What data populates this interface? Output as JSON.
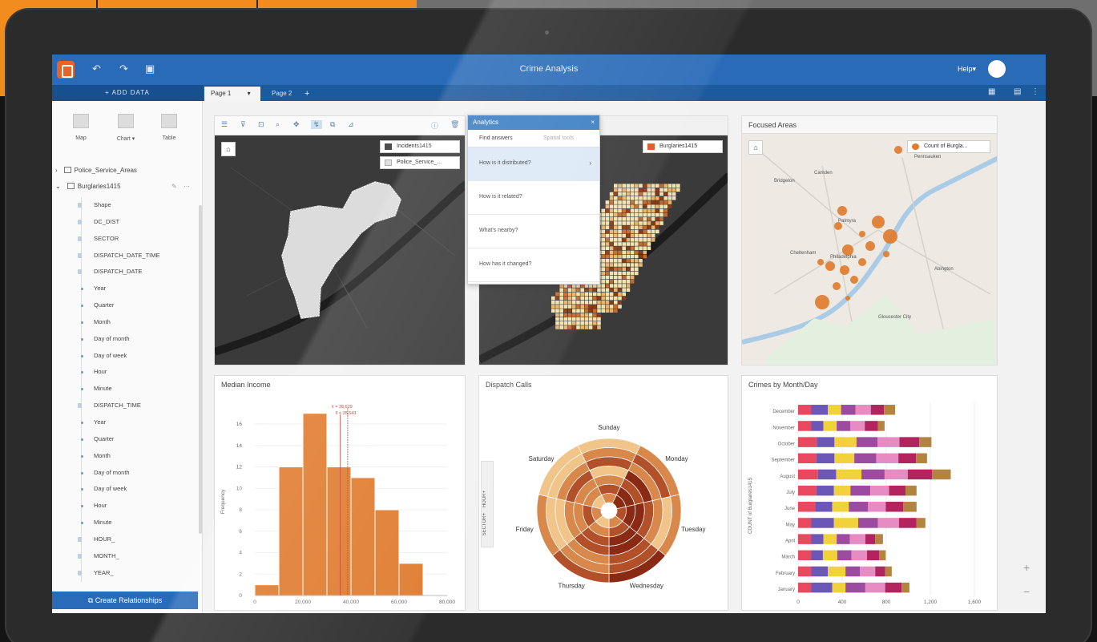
{
  "app": {
    "title": "Crime Analysis",
    "help_label": "Help",
    "add_data_label": "+ ADD DATA",
    "tabs": [
      {
        "label": "Page 1"
      },
      {
        "label": "Page 2"
      }
    ],
    "add_tab_symbol": "+"
  },
  "left_pane": {
    "viz_buttons": [
      {
        "label": "Map"
      },
      {
        "label": "Chart ▾"
      },
      {
        "label": "Table"
      }
    ],
    "datasets": [
      {
        "label": "Police_Service_Areas"
      },
      {
        "label": "Burglaries1415"
      }
    ],
    "fields": [
      {
        "label": "Shape",
        "sub": false
      },
      {
        "label": "DC_DIST",
        "sub": false
      },
      {
        "label": "SECTOR",
        "sub": false
      },
      {
        "label": "DISPATCH_DATE_TIME",
        "sub": false
      },
      {
        "label": "DISPATCH_DATE",
        "sub": false
      },
      {
        "label": "Year",
        "sub": true
      },
      {
        "label": "Quarter",
        "sub": true
      },
      {
        "label": "Month",
        "sub": true
      },
      {
        "label": "Day of month",
        "sub": true
      },
      {
        "label": "Day of week",
        "sub": true
      },
      {
        "label": "Hour",
        "sub": true
      },
      {
        "label": "Minute",
        "sub": true
      },
      {
        "label": "DISPATCH_TIME",
        "sub": false
      },
      {
        "label": "Year",
        "sub": true
      },
      {
        "label": "Quarter",
        "sub": true
      },
      {
        "label": "Month",
        "sub": true
      },
      {
        "label": "Day of month",
        "sub": true
      },
      {
        "label": "Day of week",
        "sub": true
      },
      {
        "label": "Hour",
        "sub": true
      },
      {
        "label": "Minute",
        "sub": true
      },
      {
        "label": "HOUR_",
        "sub": false
      },
      {
        "label": "MONTH_",
        "sub": false
      },
      {
        "label": "YEAR_",
        "sub": false
      }
    ],
    "create_relationships_label": "Create Relationships"
  },
  "map1": {
    "legend": [
      {
        "label": "Incidents1415",
        "color": "#4d4d4d"
      },
      {
        "label": "Police_Service_...",
        "color": "#e0e0e0"
      }
    ]
  },
  "map2": {
    "legend": [
      {
        "label": "Burglaries1415",
        "color": "#d9591e"
      }
    ]
  },
  "analytics": {
    "title": "Analytics",
    "close": "×",
    "tabs": [
      "Find answers",
      "Spatial tools"
    ],
    "questions": [
      "How is it distributed?",
      "How is it related?",
      "What's nearby?",
      "How has it changed?"
    ]
  },
  "focused_areas": {
    "title": "Focused Areas",
    "legend_label": "Count of Burgla...",
    "places": [
      "Bridgeton",
      "Camden",
      "Palmyra",
      "Pennsauken",
      "Philadelphia",
      "Gloucester City",
      "Cheltenham",
      "Abington"
    ]
  },
  "colors": {
    "header_blue": "#2a6bb8",
    "accent_orange": "#e07b2e",
    "frame_orange": "#f28c1e"
  },
  "chart_data": [
    {
      "type": "bar",
      "title": "Median Income",
      "ylabel": "Frequency",
      "xlabel": "",
      "bins": [
        [
          0,
          10000
        ],
        [
          10000,
          20000
        ],
        [
          20000,
          30000
        ],
        [
          30000,
          40000
        ],
        [
          40000,
          50000
        ],
        [
          50000,
          60000
        ],
        [
          60000,
          70000
        ],
        [
          70000,
          80000
        ]
      ],
      "values": [
        1,
        12,
        17,
        12,
        11,
        8,
        3,
        0
      ],
      "xticks": [
        "0",
        "20,000",
        "40,000",
        "60,000",
        "80,000"
      ],
      "xtick_values": [
        0,
        20000,
        40000,
        60000,
        80000
      ],
      "yticks": [
        0,
        2,
        4,
        6,
        8,
        10,
        12,
        14,
        16
      ],
      "xlim": [
        0,
        80000
      ],
      "ylim": [
        0,
        17.5
      ],
      "mean_label": "x̄ = 38,629",
      "median_label": "x̃ = 35,543",
      "mean": 38629,
      "median": 35543,
      "bar_color": "#e07b2e"
    },
    {
      "type": "heatmap",
      "title": "Dispatch Calls",
      "side_labels": [
        "HOUR+",
        "SECTOR+"
      ],
      "categories": [
        "Sunday",
        "Monday",
        "Tuesday",
        "Wednesday",
        "Thursday",
        "Friday",
        "Saturday"
      ],
      "rings": 7,
      "intensity": [
        [
          2,
          3,
          2,
          1,
          3,
          2,
          1
        ],
        [
          4,
          4,
          3,
          4,
          2,
          3,
          2
        ],
        [
          3,
          4,
          4,
          3,
          2,
          1,
          2
        ],
        [
          2,
          3,
          4,
          4,
          3,
          3,
          4
        ],
        [
          1,
          2,
          3,
          3,
          2,
          2,
          3
        ],
        [
          2,
          3,
          2,
          2,
          1,
          1,
          2
        ],
        [
          1,
          2,
          2,
          3,
          2,
          1,
          1
        ]
      ],
      "palette": [
        "#fbe9c2",
        "#f1c48a",
        "#d9884c",
        "#b2502a",
        "#8a2a15"
      ]
    },
    {
      "type": "bar",
      "title": "Crimes by Month/Day",
      "ylabel": "COUNT of Burglaries1415",
      "categories": [
        "December",
        "November",
        "October",
        "September",
        "August",
        "July",
        "June",
        "May",
        "April",
        "March",
        "February",
        "January"
      ],
      "xticks": [
        "0",
        "400",
        "800",
        "1,200",
        "1,600"
      ],
      "xtick_values": [
        0,
        400,
        800,
        1200,
        1600
      ],
      "xlim": [
        0,
        1600
      ],
      "stacked": true,
      "series": [
        {
          "color": "#e8495f",
          "values": [
            120,
            120,
            170,
            165,
            180,
            165,
            160,
            120,
            120,
            120,
            120,
            120
          ]
        },
        {
          "color": "#6a57b8",
          "values": [
            150,
            110,
            160,
            165,
            165,
            160,
            150,
            205,
            110,
            105,
            150,
            190
          ]
        },
        {
          "color": "#f2d23a",
          "values": [
            120,
            120,
            200,
            180,
            230,
            150,
            150,
            220,
            120,
            130,
            160,
            120
          ]
        },
        {
          "color": "#9b4ca0",
          "values": [
            130,
            125,
            190,
            200,
            210,
            180,
            175,
            180,
            120,
            130,
            130,
            180
          ]
        },
        {
          "color": "#e78cc3",
          "values": [
            140,
            130,
            200,
            200,
            210,
            170,
            160,
            190,
            140,
            140,
            140,
            180
          ]
        },
        {
          "color": "#b3235e",
          "values": [
            120,
            120,
            180,
            160,
            220,
            150,
            160,
            160,
            90,
            110,
            90,
            150
          ]
        },
        {
          "color": "#b38440",
          "values": [
            100,
            60,
            110,
            100,
            170,
            100,
            120,
            80,
            70,
            60,
            60,
            70
          ]
        }
      ]
    }
  ]
}
